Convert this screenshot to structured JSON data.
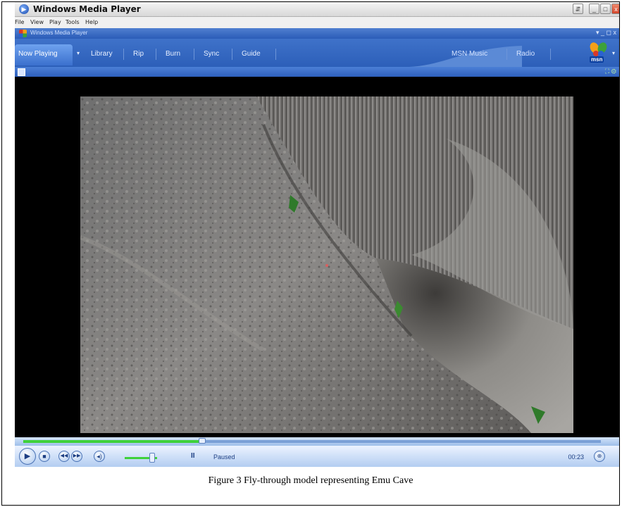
{
  "window": {
    "title": "Windows Media Player",
    "min_label": "_",
    "max_label": "□",
    "close_label": "x"
  },
  "menu": {
    "items": [
      "File",
      "View",
      "Play",
      "Tools",
      "Help"
    ]
  },
  "inner_bar": {
    "title": "Windows Media Player",
    "controls": "▾ _ ◻ x"
  },
  "tabs": {
    "now_playing": "Now Playing",
    "library": "Library",
    "rip": "Rip",
    "burn": "Burn",
    "sync": "Sync",
    "guide": "Guide",
    "msn_music": "MSN Music",
    "radio": "Radio",
    "msn_logo_text": "msn"
  },
  "player": {
    "status": "Paused",
    "time": "00:23",
    "seek_progress": 0.31,
    "volume_level": 0.85,
    "pause_glyph": "II"
  },
  "colors": {
    "accent_blue": "#2c5fb9",
    "progress_green": "#3fd13a"
  },
  "caption": "Figure 3 Fly-through model representing Emu Cave"
}
